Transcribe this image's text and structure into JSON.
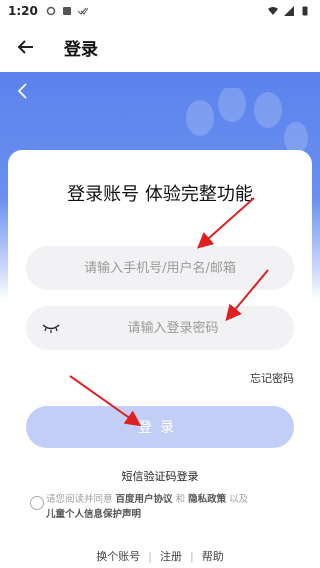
{
  "status_bar": {
    "time": "1:20"
  },
  "app_bar": {
    "title": "登录"
  },
  "form": {
    "headline": "登录账号 体验完整功能",
    "username_placeholder": "请输入手机号/用户名/邮箱",
    "password_placeholder": "请输入登录密码",
    "forgot_label": "忘记密码",
    "login_label": "登录",
    "sms_login_label": "短信验证码登录",
    "agreement": {
      "prefix": "请您阅读并同意 ",
      "user_agreement": "百度用户协议",
      "and": " 和 ",
      "privacy_policy": "隐私政策",
      "and2": " 以及",
      "children_policy": "儿童个人信息保护声明"
    }
  },
  "footer": {
    "switch_account": "换个账号",
    "register": "注册",
    "help": "帮助"
  },
  "colors": {
    "brand_blue": "#5b83ec",
    "login_button": "#c2cef5",
    "annotation_arrow": "#e02020"
  }
}
